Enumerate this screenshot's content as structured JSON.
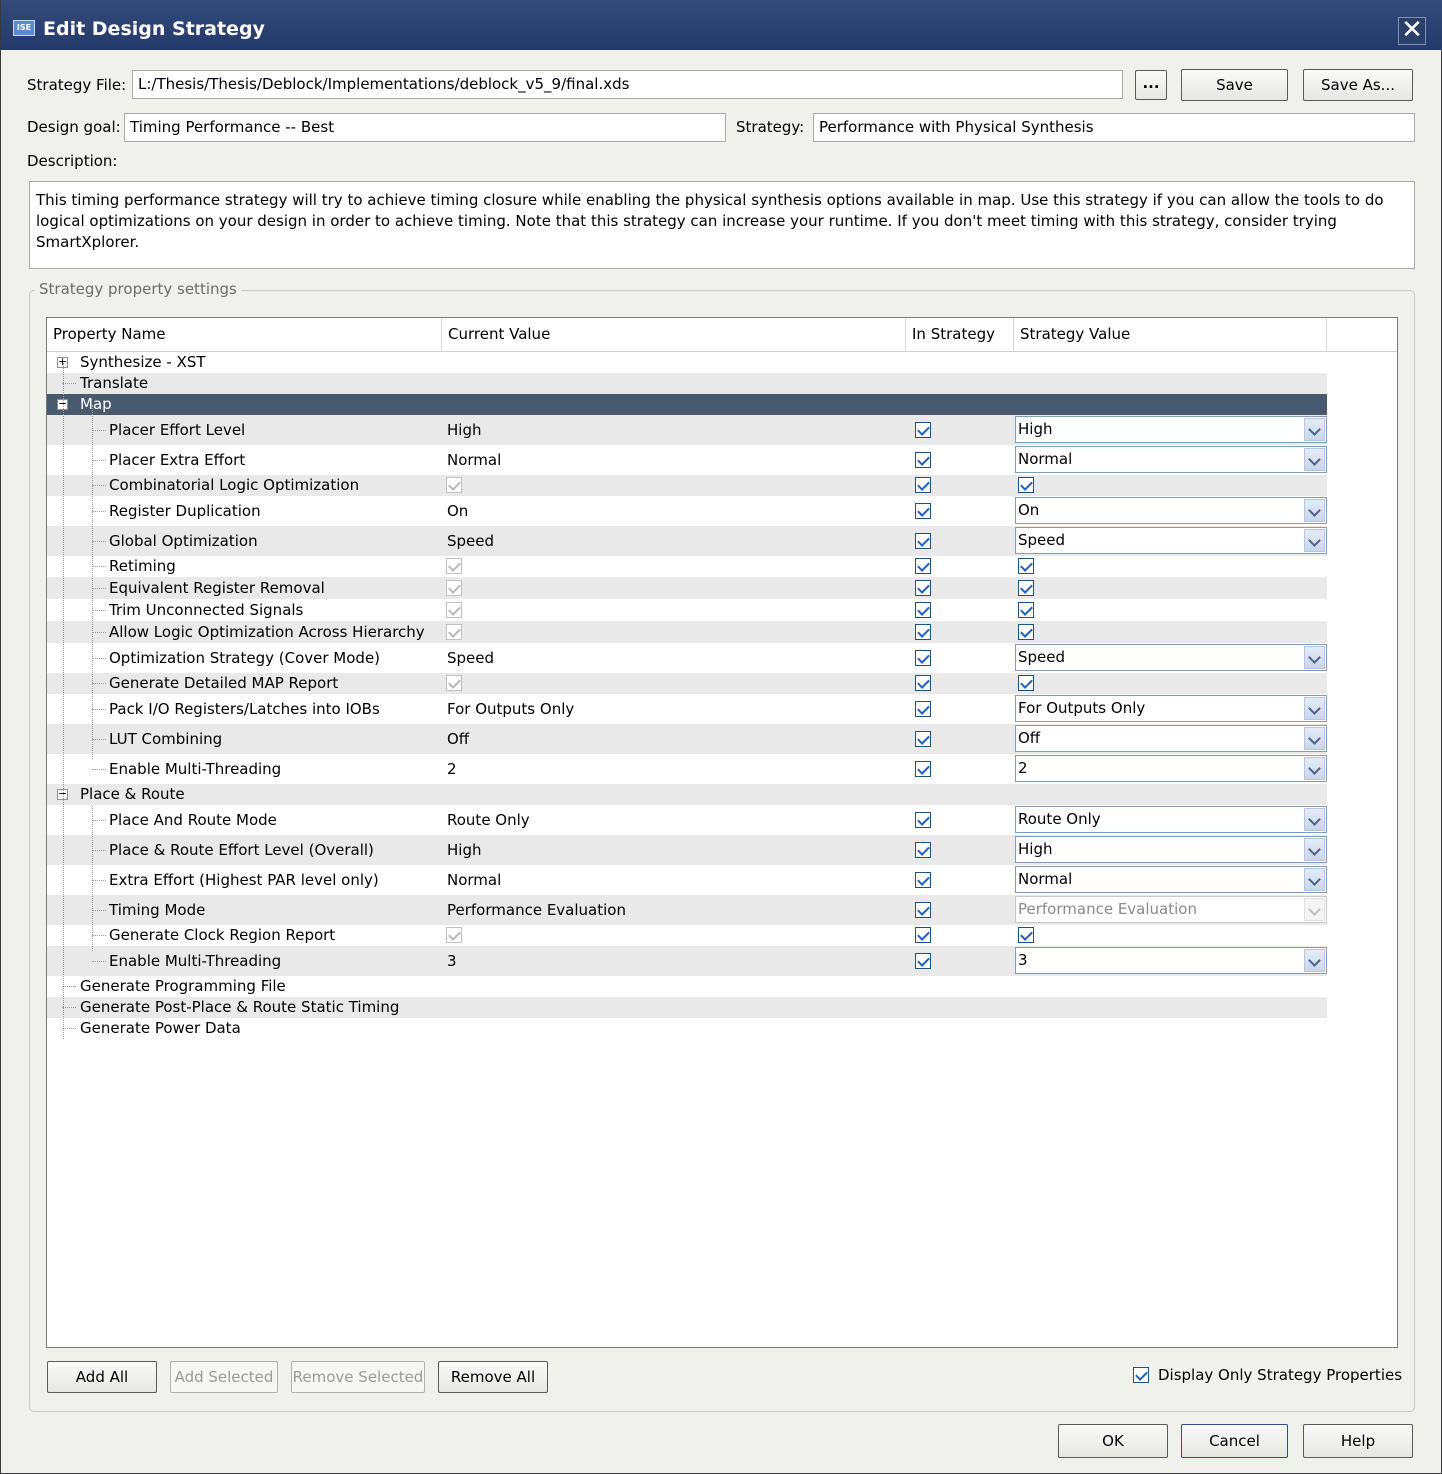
{
  "window": {
    "title": "Edit Design Strategy",
    "icon_text": "ISE"
  },
  "strategy_file": {
    "label": "Strategy File:",
    "value": "L:/Thesis/Thesis/Deblock/Implementations/deblock_v5_9/final.xds",
    "browse_label": "...",
    "save_label": "Save",
    "save_as_label": "Save As..."
  },
  "design_goal": {
    "label": "Design goal:",
    "value": "Timing Performance -- Best"
  },
  "strategy": {
    "label": "Strategy:",
    "value": "Performance with Physical Synthesis"
  },
  "description": {
    "label": "Description:",
    "text": "This timing performance strategy will try to achieve timing closure while enabling the physical synthesis options available in map.  Use this strategy if you can allow the tools to do logical optimizations on your design in order to achieve timing.  Note that this strategy can increase your runtime.  If you don't meet timing with this strategy, consider trying SmartXplorer."
  },
  "settings_group": {
    "title": "Strategy property settings"
  },
  "table": {
    "columns": [
      "Property Name",
      "Current Value",
      "In Strategy",
      "Strategy Value"
    ],
    "rows": [
      {
        "name": "Synthesize - XST",
        "type": "group",
        "toggle": "+"
      },
      {
        "name": "Translate",
        "type": "leafgroup"
      },
      {
        "name": "Map",
        "type": "group",
        "toggle": "-",
        "selected": true
      },
      {
        "name": "Placer Effort Level",
        "current": "High",
        "in_strategy": true,
        "kind": "dd",
        "strategy_value": "High"
      },
      {
        "name": "Placer Extra Effort",
        "current": "Normal",
        "in_strategy": true,
        "kind": "dd",
        "strategy_value": "Normal"
      },
      {
        "name": "Combinatorial Logic Optimization",
        "current_checked": true,
        "in_strategy": true,
        "kind": "cb",
        "strategy_checked": true
      },
      {
        "name": "Register Duplication",
        "current": "On",
        "in_strategy": true,
        "kind": "dd",
        "strategy_value": "On"
      },
      {
        "name": "Global Optimization",
        "current": "Speed",
        "in_strategy": true,
        "kind": "dd",
        "strategy_value": "Speed"
      },
      {
        "name": "Retiming",
        "current_checked": true,
        "in_strategy": true,
        "kind": "cb",
        "strategy_checked": true
      },
      {
        "name": "Equivalent Register Removal",
        "current_checked": true,
        "in_strategy": true,
        "kind": "cb",
        "strategy_checked": true
      },
      {
        "name": "Trim Unconnected Signals",
        "current_checked": true,
        "in_strategy": true,
        "kind": "cb",
        "strategy_checked": true
      },
      {
        "name": "Allow Logic Optimization Across Hierarchy",
        "current_checked": true,
        "in_strategy": true,
        "kind": "cb",
        "strategy_checked": true
      },
      {
        "name": "Optimization Strategy (Cover Mode)",
        "current": "Speed",
        "in_strategy": true,
        "kind": "dd",
        "strategy_value": "Speed"
      },
      {
        "name": "Generate Detailed MAP Report",
        "current_checked": true,
        "in_strategy": true,
        "kind": "cb",
        "strategy_checked": true
      },
      {
        "name": "Pack I/O Registers/Latches into IOBs",
        "current": "For Outputs Only",
        "in_strategy": true,
        "kind": "dd",
        "strategy_value": "For Outputs Only"
      },
      {
        "name": "LUT Combining",
        "current": "Off",
        "in_strategy": true,
        "kind": "dd",
        "strategy_value": "Off"
      },
      {
        "name": "Enable Multi-Threading",
        "current": "2",
        "in_strategy": true,
        "kind": "dd",
        "strategy_value": "2"
      },
      {
        "name": "Place & Route",
        "type": "group",
        "toggle": "-"
      },
      {
        "name": "Place And Route Mode",
        "current": "Route Only",
        "in_strategy": true,
        "kind": "dd",
        "strategy_value": "Route Only"
      },
      {
        "name": "Place & Route Effort Level (Overall)",
        "current": "High",
        "in_strategy": true,
        "kind": "dd",
        "strategy_value": "High"
      },
      {
        "name": "Extra Effort (Highest PAR level only)",
        "current": "Normal",
        "in_strategy": true,
        "kind": "dd",
        "strategy_value": "Normal"
      },
      {
        "name": "Timing Mode",
        "current": "Performance Evaluation",
        "in_strategy": true,
        "kind": "dd",
        "strategy_value": "Performance Evaluation",
        "disabled": true
      },
      {
        "name": "Generate Clock Region Report",
        "current_checked": true,
        "in_strategy": true,
        "kind": "cb",
        "strategy_checked": true
      },
      {
        "name": "Enable Multi-Threading",
        "current": "3",
        "in_strategy": true,
        "kind": "dd",
        "strategy_value": "3"
      },
      {
        "name": "Generate Programming File",
        "type": "leafgroup"
      },
      {
        "name": "Generate Post-Place & Route Static Timing",
        "type": "leafgroup"
      },
      {
        "name": "Generate Power Data",
        "type": "leafgroup"
      }
    ]
  },
  "buttons": {
    "add_all": "Add All",
    "add_selected": "Add Selected",
    "remove_selected": "Remove Selected",
    "remove_all": "Remove All",
    "ok": "OK",
    "cancel": "Cancel",
    "help": "Help"
  },
  "display_only": {
    "label": "Display Only Strategy Properties",
    "checked": true
  }
}
